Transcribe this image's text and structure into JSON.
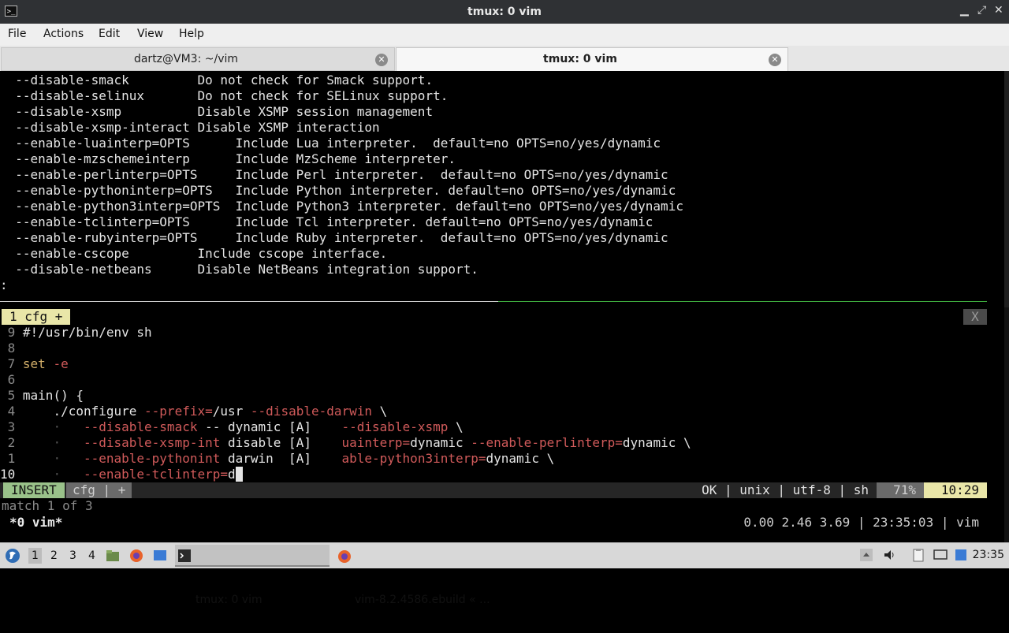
{
  "window": {
    "title": "tmux: 0 vim",
    "app_icon_glyph": ">_",
    "minimize": "▁",
    "restore": "⤢",
    "close": "✕"
  },
  "menu": [
    "File",
    "Actions",
    "Edit",
    "View",
    "Help"
  ],
  "tabs": [
    {
      "label": "dartz@VM3: ~/vim",
      "close": "✕"
    },
    {
      "label": "tmux: 0 vim",
      "close": "✕"
    }
  ],
  "output_lines": [
    "  --disable-smack         Do not check for Smack support.",
    "  --disable-selinux       Do not check for SELinux support.",
    "  --disable-xsmp          Disable XSMP session management",
    "  --disable-xsmp-interact Disable XSMP interaction",
    "  --enable-luainterp=OPTS      Include Lua interpreter.  default=no OPTS=no/yes/dynamic",
    "  --enable-mzschemeinterp      Include MzScheme interpreter.",
    "  --enable-perlinterp=OPTS     Include Perl interpreter.  default=no OPTS=no/yes/dynamic",
    "  --enable-pythoninterp=OPTS   Include Python interpreter. default=no OPTS=no/yes/dynamic",
    "  --enable-python3interp=OPTS  Include Python3 interpreter. default=no OPTS=no/yes/dynamic",
    "  --enable-tclinterp=OPTS      Include Tcl interpreter. default=no OPTS=no/yes/dynamic",
    "  --enable-rubyinterp=OPTS     Include Ruby interpreter.  default=no OPTS=no/yes/dynamic",
    "  --enable-cscope         Include cscope interface.",
    "  --disable-netbeans      Disable NetBeans integration support."
  ],
  "pager_prompt": ":",
  "vim_tabline": {
    "current": "1 cfg +",
    "close": "X"
  },
  "editor": {
    "ln9": " 9",
    "l9": "#!/usr/bin/env sh",
    "ln8": " 8",
    "ln7": " 7",
    "l7_kw": "set",
    "l7_opt": "-e",
    "ln6": " 6",
    "ln5": " 5",
    "l5": "main() {",
    "ln4": " 4",
    "l4_a": "    ./configure ",
    "l4_b": "--prefix=",
    "l4_c": "/usr ",
    "l4_d": "--disable-darwin",
    "l4_e": " \\",
    "ln3": " 3",
    "l3_dot": "    ·   ",
    "l3_a": "--disable-smack",
    "l3_b": " -- dynamic [A]    ",
    "l3_c": "--disable-xsmp",
    "l3_d": " \\",
    "ln2": " 2",
    "l2_dot": "    ·   ",
    "l2_a": "--disable-xsmp-int",
    "l2_b": " disable [A]    ",
    "l2_c": "uainterp=",
    "l2_d": "dynamic ",
    "l2_e": "--enable-perlinterp=",
    "l2_f": "dynamic \\",
    "ln1": " 1",
    "l1_dot": "    ·   ",
    "l1_a": "--enable-pythonint",
    "l1_b": " darwin  [A]    ",
    "l1_c": "able-python3interp=",
    "l1_d": "dynamic \\",
    "ln10": "10",
    "l10_dot": "    ·   ",
    "l10_a": "--enable-tclinterp=",
    "l10_b": "d",
    "cursor_char": " "
  },
  "statusline": {
    "mode": "INSERT",
    "filename": "cfg | +",
    "info": "OK | unix | utf-8 | sh",
    "percent": "71%",
    "position": "10:29"
  },
  "message": "match 1 of 3",
  "tmux": {
    "window": "*0 vim*",
    "status": "0.00 2.46 3.69 | 23:35:03 | vim"
  },
  "taskbar": {
    "workspaces": [
      "1",
      "2",
      "3",
      "4"
    ],
    "tasks": [
      {
        "label": "tmux: 0 vim"
      },
      {
        "label": "vim-8.2.4586.ebuild « ..."
      }
    ],
    "clock": "23:35",
    "colors": {
      "firefox": "#e8622a",
      "terminal": "#2b2b2b",
      "files": "#3a7bd5",
      "start": "#2f6db5"
    }
  }
}
